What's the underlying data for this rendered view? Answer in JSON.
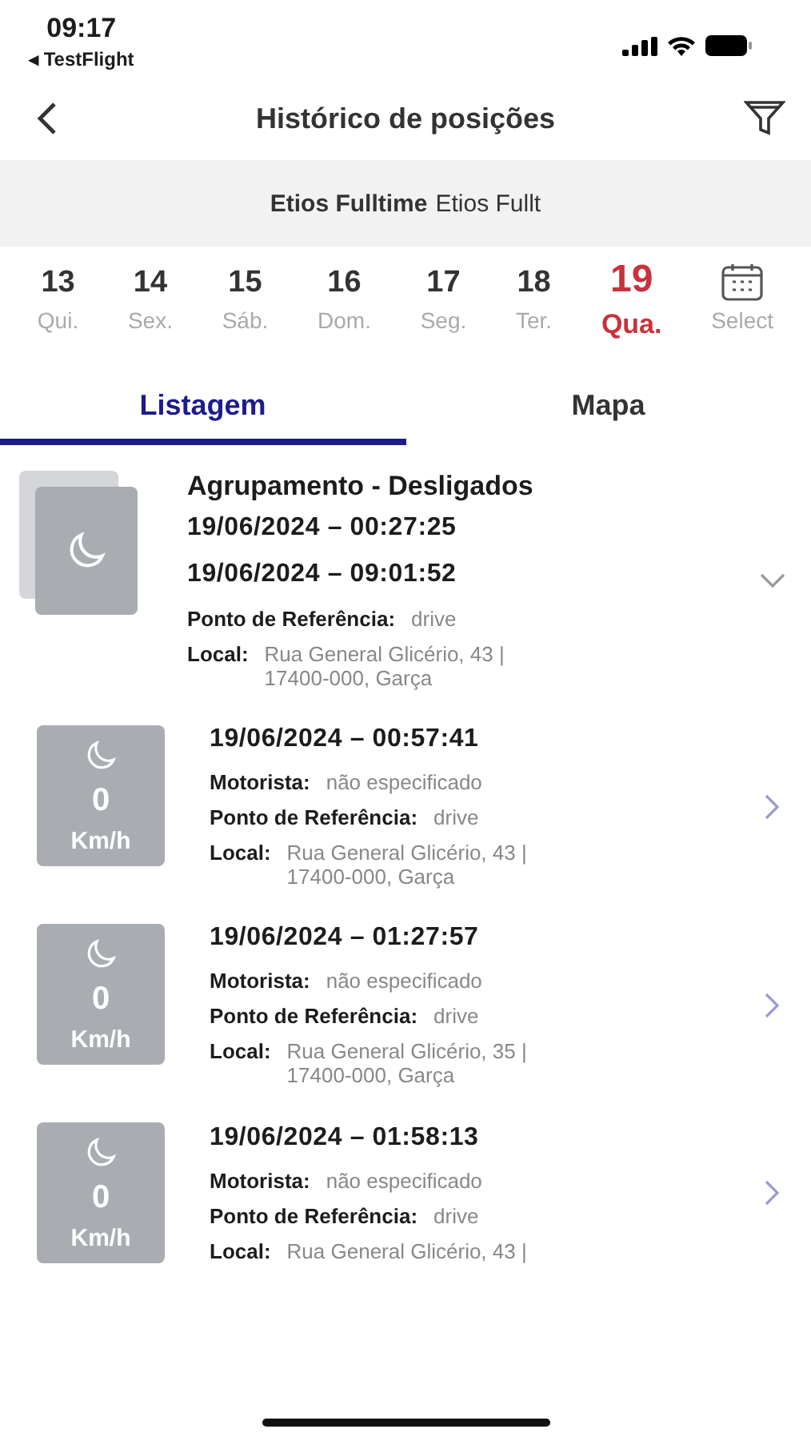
{
  "status_bar": {
    "time": "09:17",
    "back_app": "◂ TestFlight"
  },
  "header": {
    "title": "Histórico de posições"
  },
  "vehicle": {
    "name": "Etios Fulltime",
    "detail": "Etios Fullt"
  },
  "days": [
    {
      "number": "13",
      "weekday": "Qui.",
      "selected": false
    },
    {
      "number": "14",
      "weekday": "Sex.",
      "selected": false
    },
    {
      "number": "15",
      "weekday": "Sáb.",
      "selected": false
    },
    {
      "number": "16",
      "weekday": "Dom.",
      "selected": false
    },
    {
      "number": "17",
      "weekday": "Seg.",
      "selected": false
    },
    {
      "number": "18",
      "weekday": "Ter.",
      "selected": false
    },
    {
      "number": "19",
      "weekday": "Qua.",
      "selected": true
    }
  ],
  "select_label": "Select",
  "tabs": [
    {
      "label": "Listagem",
      "selected": true
    },
    {
      "label": "Mapa",
      "selected": false
    }
  ],
  "entries": [
    {
      "kind": "group",
      "title": "Agrupamento - Desligados",
      "times": [
        "19/06/2024 – 00:27:25",
        "19/06/2024 – 09:01:52"
      ],
      "fields": [
        {
          "label": "Ponto de Referência:",
          "value": [
            "drive"
          ]
        },
        {
          "label": "Local:",
          "value": [
            "Rua General Glicério, 43 |",
            "17400-000, Garça"
          ]
        }
      ],
      "expanded": false
    },
    {
      "kind": "position",
      "speed": "0",
      "unit": "Km/h",
      "times": [
        "19/06/2024 – 00:57:41"
      ],
      "fields": [
        {
          "label": "Motorista:",
          "value": [
            "não especificado"
          ]
        },
        {
          "label": "Ponto de Referência:",
          "value": [
            "drive"
          ]
        },
        {
          "label": "Local:",
          "value": [
            "Rua General Glicério, 43 |",
            "17400-000, Garça"
          ]
        }
      ]
    },
    {
      "kind": "position",
      "speed": "0",
      "unit": "Km/h",
      "times": [
        "19/06/2024 – 01:27:57"
      ],
      "fields": [
        {
          "label": "Motorista:",
          "value": [
            "não especificado"
          ]
        },
        {
          "label": "Ponto de Referência:",
          "value": [
            "drive"
          ]
        },
        {
          "label": "Local:",
          "value": [
            "Rua General Glicério, 35 |",
            "17400-000, Garça"
          ]
        }
      ]
    },
    {
      "kind": "position",
      "speed": "0",
      "unit": "Km/h",
      "times": [
        "19/06/2024 – 01:58:13"
      ],
      "fields": [
        {
          "label": "Motorista:",
          "value": [
            "não especificado"
          ]
        },
        {
          "label": "Ponto de Referência:",
          "value": [
            "drive"
          ]
        },
        {
          "label": "Local:",
          "value": [
            "Rua General Glicério, 43 |"
          ]
        }
      ]
    }
  ]
}
